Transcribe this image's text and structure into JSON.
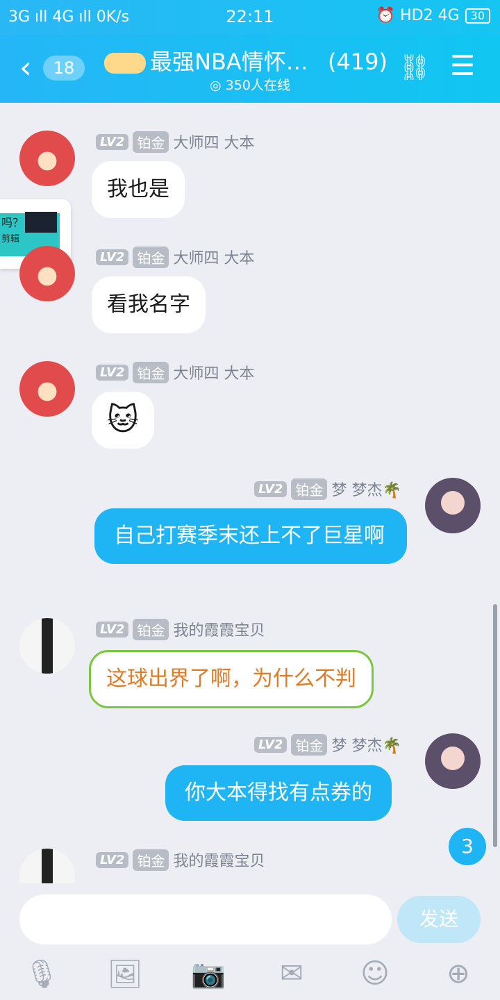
{
  "status_bar": {
    "left": "3G ıll 4G ıll 0K/s",
    "time": "22:11",
    "right": "⏰ HD2 4G",
    "battery": "30"
  },
  "header": {
    "back_count": "18",
    "title": "最强NBA情怀…",
    "member_count": "(419)",
    "online": "350人在线"
  },
  "popup": {
    "line1": "吗？",
    "line2": "剪辑"
  },
  "messages": [
    {
      "lv": "LV2",
      "level": "铂金",
      "name": "大师四  大本",
      "text": "我也是"
    },
    {
      "lv": "LV2",
      "level": "铂金",
      "name": "大师四  大本",
      "text": "看我名字"
    },
    {
      "lv": "LV2",
      "level": "铂金",
      "name": "大师四  大本",
      "text": "🐱"
    },
    {
      "lv": "LV2",
      "level": "铂金",
      "name": "梦 梦杰🌴",
      "text": "自己打赛季末还上不了巨星啊"
    },
    {
      "lv": "LV2",
      "level": "铂金",
      "name": "我的霞霞宝贝",
      "text": "这球出界了啊，为什么不判"
    },
    {
      "lv": "LV2",
      "level": "铂金",
      "name": "梦 梦杰🌴",
      "text": "你大本得找有点券的"
    },
    {
      "lv": "LV2",
      "level": "铂金",
      "name": "我的霞霞宝贝",
      "text": ""
    }
  ],
  "unread": "3",
  "composer": {
    "send_label": "发送"
  },
  "colors": {
    "accent": "#1fb5f5",
    "header": "#25b6f7"
  }
}
